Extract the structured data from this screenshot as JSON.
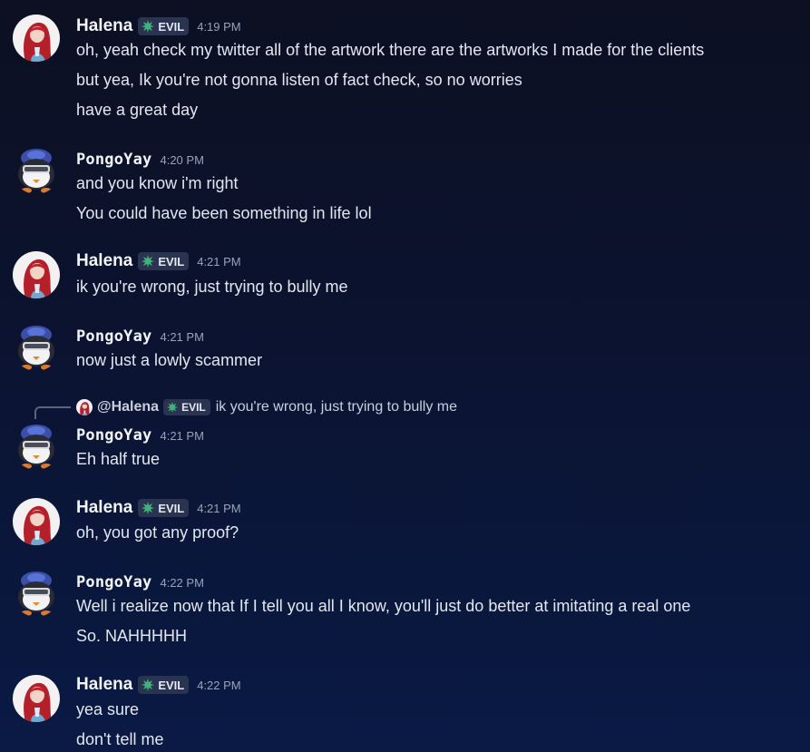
{
  "users": {
    "halena": {
      "name": "Halena",
      "tag": "EVIL"
    },
    "pongo": {
      "name": "PongoYay"
    }
  },
  "colors": {
    "background": "#0b1330",
    "tag_bg": "#2a3350",
    "leaf": "#3fb37a",
    "timestamp": "#9aa3b8"
  },
  "icons": {
    "tag_icon": "leaf-icon"
  },
  "messages": [
    {
      "author": "Halena",
      "tag": "EVIL",
      "time": "4:19 PM",
      "lines": [
        "oh, yeah check my twitter all of the artwork there are the artworks I made for the clients",
        "but yea, Ik you're not gonna listen of fact check, so no worries",
        "have a great day"
      ]
    },
    {
      "author": "PongoYay",
      "time": "4:20 PM",
      "lines": [
        "and you know i'm right",
        "You could have been something in life lol"
      ]
    },
    {
      "author": "Halena",
      "tag": "EVIL",
      "time": "4:21 PM",
      "lines": [
        "ik you're wrong, just trying to bully me"
      ]
    },
    {
      "author": "PongoYay",
      "time": "4:21 PM",
      "lines": [
        "now just a lowly scammer"
      ]
    },
    {
      "author": "PongoYay",
      "time": "4:21 PM",
      "reply": {
        "mention": "@Halena",
        "tag": "EVIL",
        "text": "ik you're wrong, just trying to bully me"
      },
      "lines": [
        "Eh half true"
      ]
    },
    {
      "author": "Halena",
      "tag": "EVIL",
      "time": "4:21 PM",
      "lines": [
        "oh, you got any proof?"
      ]
    },
    {
      "author": "PongoYay",
      "time": "4:22 PM",
      "lines": [
        "Well i realize now that If I tell you all I know, you'll just do better at imitating a real one",
        "So. NAHHHHH"
      ]
    },
    {
      "author": "Halena",
      "tag": "EVIL",
      "time": "4:22 PM",
      "lines": [
        "yea sure",
        "don't tell me"
      ]
    }
  ]
}
